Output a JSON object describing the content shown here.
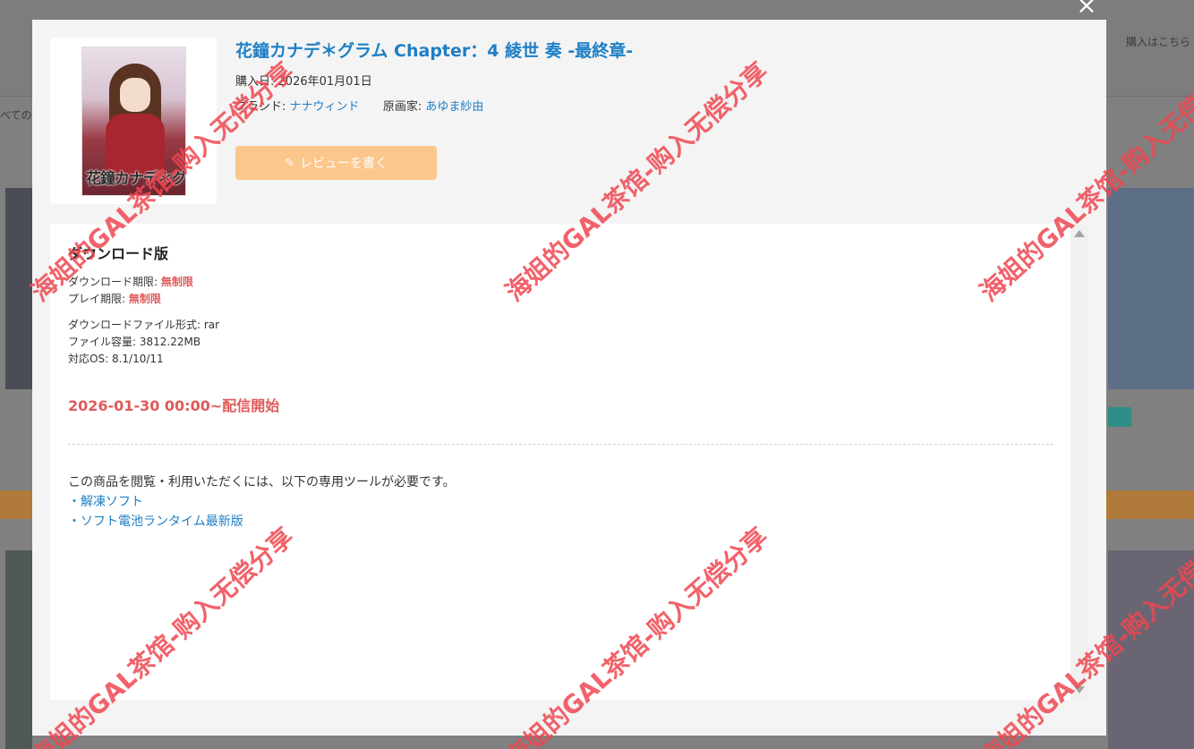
{
  "background": {
    "top_right_text": "購入はこちら",
    "left_label": "べての"
  },
  "modal": {
    "close_glyph": "×",
    "product": {
      "title": "花鐘カナデ＊グラム Chapter：4 綾世 奏 -最終章-",
      "purchase_label": "購入日:",
      "purchase_date": "2026年01月01日",
      "brand_label": "ブランド:",
      "brand": "ナナウィンド",
      "artist_label": "原画家:",
      "artist": "あゆま紗由",
      "cover_logo": "花鐘カナデ＊グラム",
      "review_button": "レビューを書く",
      "review_icon": "pencil-icon"
    },
    "download": {
      "section_title": "ダウンロード版",
      "download_limit_label": "ダウンロード期限:",
      "download_limit": "無制限",
      "play_limit_label": "プレイ期限:",
      "play_limit": "無制限",
      "format_label": "ダウンロードファイル形式:",
      "format": "rar",
      "size_label": "ファイル容量:",
      "size": "3812.22MB",
      "os_label": "対応OS:",
      "os": "8.1/10/11",
      "release": "2026-01-30 00:00~配信開始",
      "requirement_text": "この商品を閲覧・利用いただくには、以下の専用ツールが必要です。",
      "tools": [
        "・解凍ソフト",
        "・ソフト電池ランタイム最新版"
      ]
    }
  },
  "watermark": "海姐的GAL茶馆-购入无偿分享",
  "colors": {
    "link_blue": "#1e7fc6",
    "alert_red": "#e05a5a",
    "review_orange": "#fbc78c",
    "watermark_red": "#ee4650"
  }
}
